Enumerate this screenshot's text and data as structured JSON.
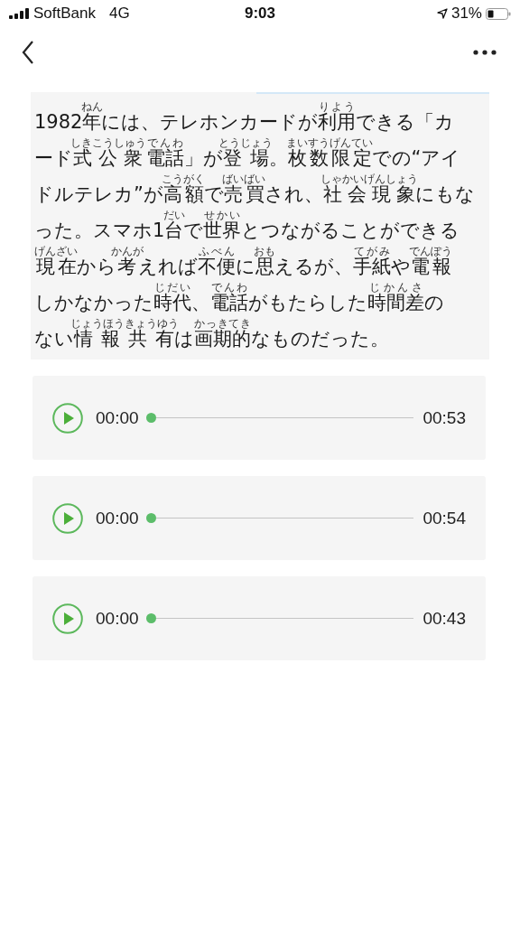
{
  "status_bar": {
    "carrier": "SoftBank",
    "network": "4G",
    "time": "9:03",
    "battery": "31%"
  },
  "passage": {
    "lines": [
      [
        {
          "text": "1982"
        },
        {
          "text": "年",
          "ruby": "ねん"
        },
        {
          "text": "には、テレホンカードが"
        },
        {
          "text": "利用",
          "ruby": "りよう"
        },
        {
          "text": "できる「カ"
        }
      ],
      [
        {
          "text": "ード"
        },
        {
          "text": "式公衆",
          "ruby": "しきこうしゅう"
        },
        {
          "text": "電話",
          "ruby": "でんわ"
        },
        {
          "text": "」が"
        },
        {
          "text": "登場",
          "ruby": "とうじょう"
        },
        {
          "text": "。"
        },
        {
          "text": "枚数限定",
          "ruby": "まいすうげんてい"
        },
        {
          "text": "での“アイ"
        }
      ],
      [
        {
          "text": "ドルテレカ”が"
        },
        {
          "text": "高額",
          "ruby": "こうがく"
        },
        {
          "text": "で"
        },
        {
          "text": "売買",
          "ruby": "ばいばい"
        },
        {
          "text": "され、"
        },
        {
          "text": "社会現象",
          "ruby": "しゃかいげんしょう"
        },
        {
          "text": "にもな"
        }
      ],
      [
        {
          "text": "った。スマホ1"
        },
        {
          "text": "台",
          "ruby": "だい"
        },
        {
          "text": "で"
        },
        {
          "text": "世界",
          "ruby": "せかい"
        },
        {
          "text": "とつながることができる"
        }
      ],
      [
        {
          "text": "現在",
          "ruby": "げんざい"
        },
        {
          "text": "から"
        },
        {
          "text": "考",
          "ruby": "かんが"
        },
        {
          "text": "えれば"
        },
        {
          "text": "不便",
          "ruby": "ふべん"
        },
        {
          "text": "に"
        },
        {
          "text": "思",
          "ruby": "おも"
        },
        {
          "text": "えるが、"
        },
        {
          "text": "手紙",
          "ruby": "てがみ"
        },
        {
          "text": "や"
        },
        {
          "text": "電報",
          "ruby": "でんぽう"
        }
      ],
      [
        {
          "text": "しかなかった"
        },
        {
          "text": "時代",
          "ruby": "じだい"
        },
        {
          "text": "、"
        },
        {
          "text": "電話",
          "ruby": "でんわ"
        },
        {
          "text": "がもたらした"
        },
        {
          "text": "時間差",
          "ruby": "じかんさ"
        },
        {
          "text": "の"
        }
      ],
      [
        {
          "text": "ない"
        },
        {
          "text": "情報",
          "ruby": "じょうほう"
        },
        {
          "text": "共有",
          "ruby": "きょうゆう"
        },
        {
          "text": "は"
        },
        {
          "text": "画期的",
          "ruby": "かっきてき"
        },
        {
          "text": "なものだった。"
        }
      ]
    ]
  },
  "audio_players": [
    {
      "current": "00:00",
      "duration": "00:53",
      "level": 0
    },
    {
      "current": "00:00",
      "duration": "00:54",
      "level": 0
    },
    {
      "current": "00:00",
      "duration": "00:43",
      "level": 0
    }
  ]
}
